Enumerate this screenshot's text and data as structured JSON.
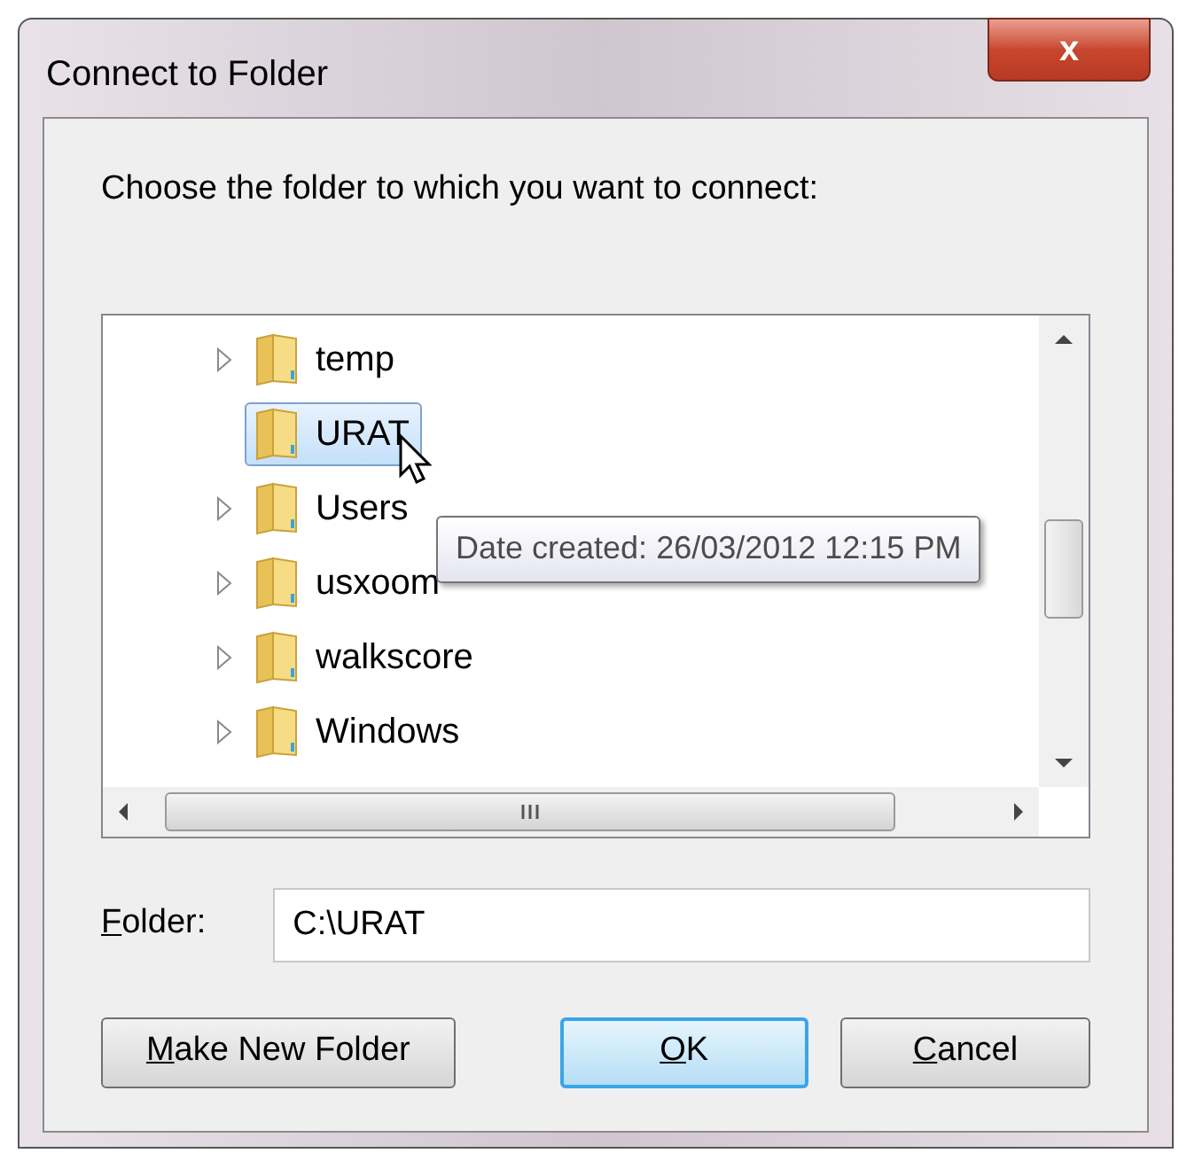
{
  "window": {
    "title": "Connect to Folder",
    "close": "x"
  },
  "prompt": "Choose the folder to which you want to connect:",
  "tree": {
    "items": [
      {
        "label": "temp",
        "expandable": true,
        "selected": false
      },
      {
        "label": "URAT",
        "expandable": false,
        "selected": true
      },
      {
        "label": "Users",
        "expandable": true,
        "selected": false
      },
      {
        "label": "usxoom",
        "expandable": true,
        "selected": false
      },
      {
        "label": "walkscore",
        "expandable": true,
        "selected": false
      },
      {
        "label": "Windows",
        "expandable": true,
        "selected": false
      }
    ],
    "tooltip": "Date created: 26/03/2012 12:15 PM"
  },
  "folder": {
    "label": "Folder:",
    "value": "C:\\URAT"
  },
  "buttons": [
    {
      "label": "Make New Folder",
      "default": false
    },
    {
      "label": "OK",
      "default": true
    },
    {
      "label": "Cancel",
      "default": false
    }
  ]
}
